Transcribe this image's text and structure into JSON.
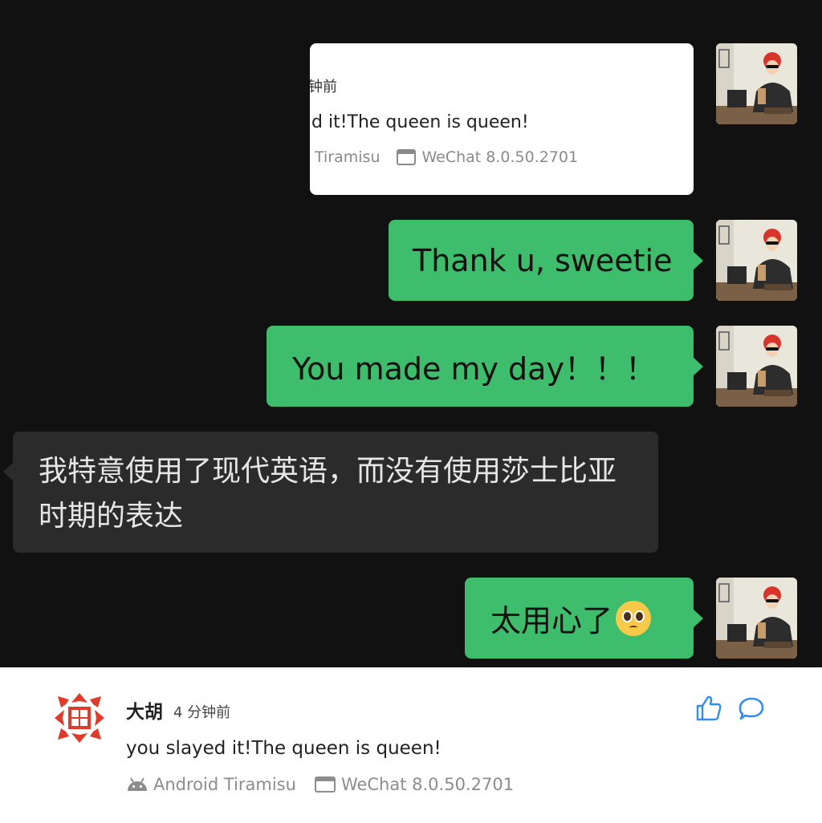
{
  "quote": {
    "time_fragment": "钟前",
    "text_fragment": "d it!The queen is queen!",
    "os_fragment": "Tiramisu",
    "app_version": "WeChat 8.0.50.2701"
  },
  "messages": [
    {
      "side": "me",
      "text": "Thank u, sweetie"
    },
    {
      "side": "me",
      "text": "You made my day！！！"
    },
    {
      "side": "other",
      "text": "我特意使用了现代英语，而没有使用莎士比亚时期的表达"
    },
    {
      "side": "me",
      "text": "太用心了",
      "emoji": "pleading-face-emoji"
    }
  ],
  "comment": {
    "username": "大胡",
    "time": "4 分钟前",
    "text": "you slayed it!The queen is queen!",
    "os": "Android Tiramisu",
    "app_version": "WeChat 8.0.50.2701"
  },
  "icons": {
    "like": "thumbs-up-icon",
    "reply": "speech-bubble-icon",
    "android": "android-icon",
    "device": "window-icon"
  },
  "colors": {
    "chat_background": "#111111",
    "my_bubble": "#3ebd6c",
    "other_bubble": "#2b2b2b",
    "accent_blue": "#2f8ef0",
    "avatar_red": "#e03a2b"
  }
}
